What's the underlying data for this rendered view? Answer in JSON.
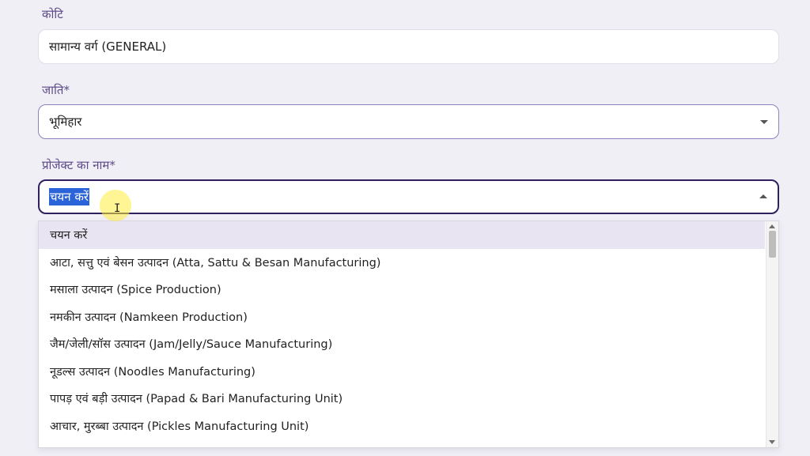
{
  "category": {
    "label": "कोटि",
    "value": "सामान्य वर्ग (GENERAL)"
  },
  "caste": {
    "label": "जाति*",
    "value": "भूमिहार"
  },
  "project": {
    "label": "प्रोजेक्ट का नाम*",
    "value": "चयन करें",
    "options": [
      "चयन करें",
      "आटा, सत्तु एवं बेसन उत्पादन (Atta, Sattu & Besan Manufacturing)",
      "मसाला उत्पादन (Spice Production)",
      "नमकीन उत्पादन (Namkeen Production)",
      "जैम/जेली/सॉस उत्पादन (Jam/Jelly/Sauce Manufacturing)",
      "नूडल्स उत्पादन (Noodles Manufacturing)",
      "पापड़ एवं बड़ी उत्पादन (Papad & Bari Manufacturing Unit)",
      "आचार, मुरब्बा उत्पादन (Pickles Manufacturing Unit)"
    ]
  },
  "colors": {
    "label_purple": "#5b4a86",
    "focus_border": "#2f2160",
    "selection_blue": "#2b64d8",
    "option_highlight": "#e8e4f2"
  }
}
